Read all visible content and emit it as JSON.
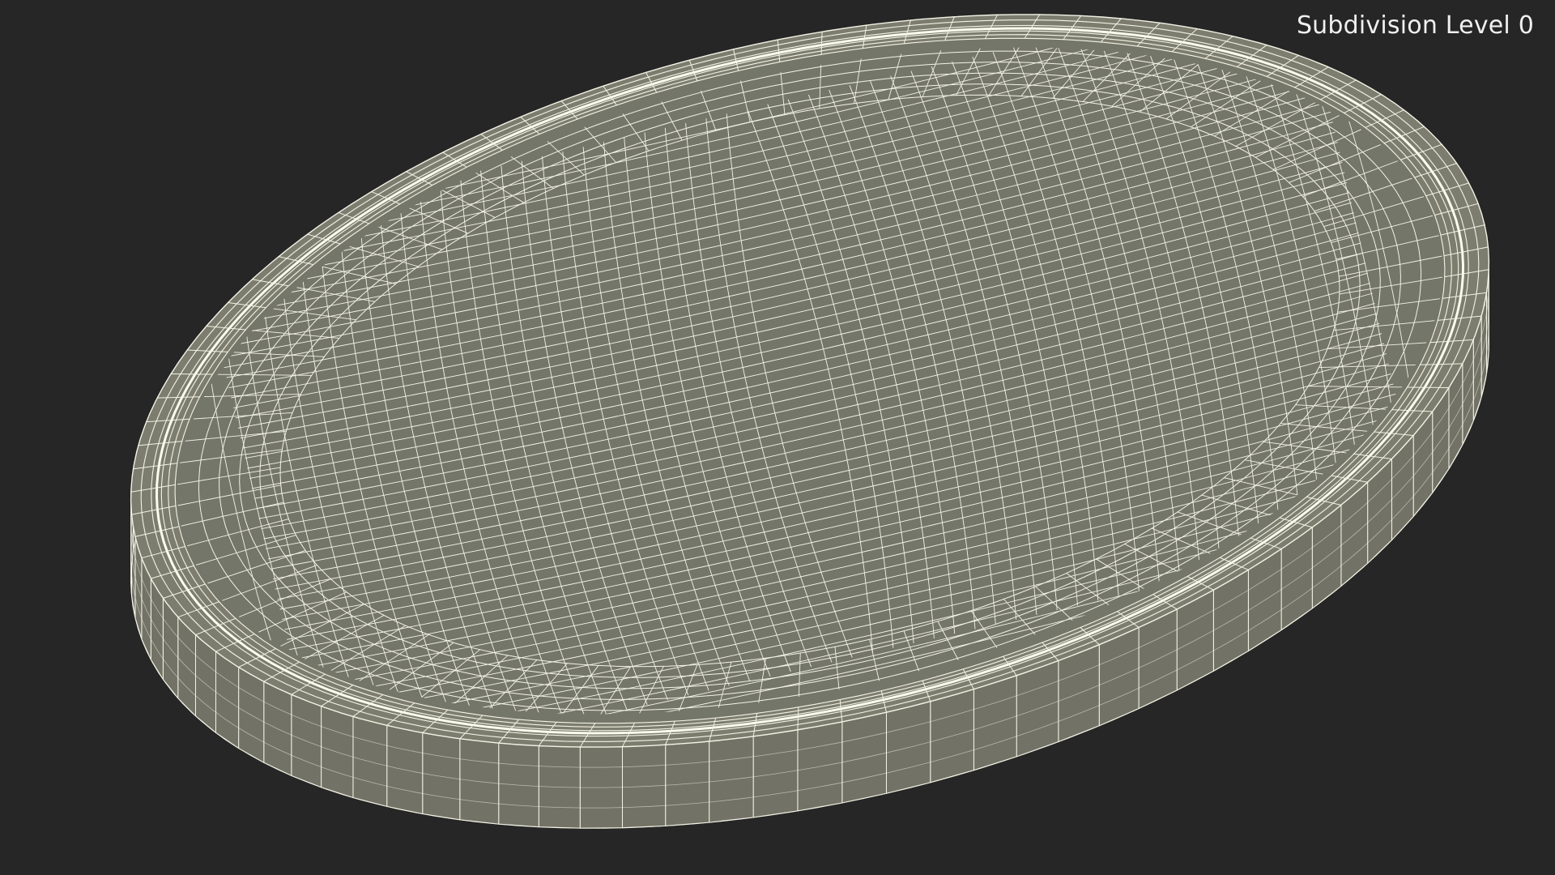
{
  "overlay": {
    "subdivision_label": "Subdivision Level 0"
  },
  "scene": {
    "model": "oval-tray-wireframe",
    "colors": {
      "background": "#262626",
      "surface": "#7c7d6f",
      "surface_inner": "#75766a",
      "side": "#727366",
      "wire": "#f3f3e6",
      "rim_highlight": "#fbfbef"
    }
  }
}
